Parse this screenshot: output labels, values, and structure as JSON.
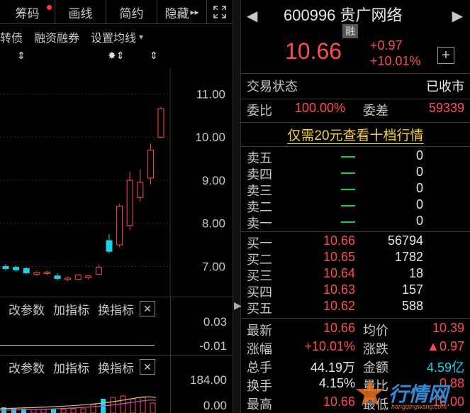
{
  "toolbar": {
    "chips": "筹码",
    "draw": "画线",
    "simple": "简约",
    "hide": "隐藏",
    "expand_arrows": "▸▸"
  },
  "toolrow": {
    "convertible": "转债",
    "margin": "融资融券",
    "ma_settings": "设置均线",
    "ma_arrow": "▾"
  },
  "markers": [
    "⇕",
    "✸⇕",
    "⇕"
  ],
  "chart_data": {
    "type": "candlestick",
    "y_ticks": [
      "11.00",
      "10.00",
      "9.00",
      "8.00",
      "7.00"
    ],
    "ylim": [
      6.3,
      11.6
    ],
    "candles": [
      {
        "o": 7.0,
        "h": 7.05,
        "l": 6.9,
        "c": 6.95,
        "up": false
      },
      {
        "o": 6.98,
        "h": 7.02,
        "l": 6.88,
        "c": 6.92,
        "up": false
      },
      {
        "o": 6.95,
        "h": 6.98,
        "l": 6.82,
        "c": 6.85,
        "up": false
      },
      {
        "o": 6.82,
        "h": 6.9,
        "l": 6.78,
        "c": 6.86,
        "up": true
      },
      {
        "o": 6.84,
        "h": 6.9,
        "l": 6.8,
        "c": 6.87,
        "up": true
      },
      {
        "o": 6.78,
        "h": 6.84,
        "l": 6.68,
        "c": 6.72,
        "up": false
      },
      {
        "o": 6.7,
        "h": 6.76,
        "l": 6.66,
        "c": 6.73,
        "up": true
      },
      {
        "o": 6.7,
        "h": 6.82,
        "l": 6.68,
        "c": 6.8,
        "up": true
      },
      {
        "o": 6.74,
        "h": 6.8,
        "l": 6.7,
        "c": 6.78,
        "up": true
      },
      {
        "o": 6.82,
        "h": 7.05,
        "l": 6.8,
        "c": 6.98,
        "up": true
      },
      {
        "o": 7.35,
        "h": 7.75,
        "l": 7.3,
        "c": 7.6,
        "up": false
      },
      {
        "o": 7.5,
        "h": 8.45,
        "l": 7.45,
        "c": 8.4,
        "up": true
      },
      {
        "o": 7.95,
        "h": 9.2,
        "l": 7.85,
        "c": 9.0,
        "up": true
      },
      {
        "o": 8.6,
        "h": 9.25,
        "l": 8.5,
        "c": 8.95,
        "up": true
      },
      {
        "o": 9.05,
        "h": 9.85,
        "l": 8.9,
        "c": 9.7,
        "up": true
      },
      {
        "o": 10.0,
        "h": 10.7,
        "l": 9.98,
        "c": 10.66,
        "up": true
      }
    ]
  },
  "indicator1": {
    "change_params": "改参数",
    "add_indicator": "加指标",
    "switch_indicator": "换指标",
    "close": "✕",
    "val_top": "0.03",
    "val_bottom": "-0.01"
  },
  "indicator2": {
    "change_params": "改参数",
    "add_indicator": "加指标",
    "switch_indicator": "换指标",
    "close": "✕",
    "val_top": "184.00",
    "val_bottom": "0.00"
  },
  "header": {
    "nav_left": "◀",
    "nav_right": "▶",
    "code": "600996",
    "name": "贵广网络",
    "rong": "融",
    "price": "10.66",
    "chg_abs": "+0.97",
    "chg_pct": "+10.01%",
    "plus": "+"
  },
  "status": {
    "label": "交易状态",
    "value": "已收市"
  },
  "weibi": {
    "label": "委比",
    "value": "100.00%",
    "label2": "委差",
    "value2": "59339"
  },
  "promo": "仅需20元查看十档行情",
  "sell": [
    {
      "label": "卖五",
      "vol": "0"
    },
    {
      "label": "卖四",
      "vol": "0"
    },
    {
      "label": "卖三",
      "vol": "0"
    },
    {
      "label": "卖二",
      "vol": "0"
    },
    {
      "label": "卖一",
      "vol": "0"
    }
  ],
  "buy": [
    {
      "label": "买一",
      "price": "10.66",
      "vol": "56794"
    },
    {
      "label": "买二",
      "price": "10.65",
      "vol": "1782"
    },
    {
      "label": "买三",
      "price": "10.64",
      "vol": "18"
    },
    {
      "label": "买四",
      "price": "10.63",
      "vol": "157"
    },
    {
      "label": "买五",
      "price": "10.62",
      "vol": "588"
    }
  ],
  "stats": [
    {
      "l": "最新",
      "v": "10.66",
      "vc": "#ff4d4d",
      "l2": "均价",
      "v2": "10.39",
      "v2c": "#ff4d4d"
    },
    {
      "l": "涨幅",
      "v": "+10.01%",
      "vc": "#ff4d4d",
      "l2": "涨跌",
      "v2": "▲0.97",
      "v2c": "#ff4d4d"
    },
    {
      "l": "总手",
      "v": "44.19万",
      "vc": "#e6e6e6",
      "l2": "金额",
      "v2": "4.59亿",
      "v2c": "#19d3e8"
    },
    {
      "l": "换手",
      "v": "4.15%",
      "vc": "#e6e6e6",
      "l2": "量比",
      "v2": "0.88",
      "v2c": "#ff4d4d"
    },
    {
      "l": "最高",
      "v": "10.66",
      "vc": "#ff4d4d",
      "l2": "最低",
      "v2": "10.00",
      "v2c": "#ff4d4d"
    }
  ],
  "watermark": {
    "text": "行情网",
    "sub": "hangqingwang.com"
  },
  "colors": {
    "up": "#ff4d4d",
    "down": "#19d3e8",
    "green": "#1fd13a"
  }
}
